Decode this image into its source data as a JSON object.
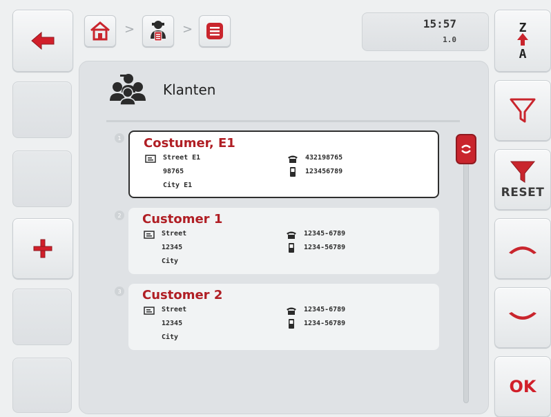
{
  "header": {
    "clock_time": "15:57",
    "version": "1.0",
    "breadcrumb_sep": ">"
  },
  "page": {
    "title": "Klanten"
  },
  "buttons": {
    "reset_label": "RESET",
    "ok_label": "OK"
  },
  "icons": {
    "back": "arrow-left-icon",
    "add": "plus-icon",
    "sort": "sort-za-icon",
    "filter": "filter-icon",
    "reset": "filter-reset-icon",
    "up": "chevron-up-icon",
    "down": "chevron-down-icon",
    "home": "home-icon",
    "customer": "customer-icon",
    "list": "list-menu-icon",
    "address": "address-icon",
    "phone": "phone-icon",
    "mobile": "mobile-icon"
  },
  "colors": {
    "accent_red": "#c9252d",
    "name_red": "#b01e24"
  },
  "customers": [
    {
      "index": "1",
      "name": "Costumer, E1",
      "street": "Street E1",
      "postcode": "98765",
      "city": "City E1",
      "phone": "432198765",
      "mobile": "123456789"
    },
    {
      "index": "2",
      "name": "Customer 1",
      "street": "Street",
      "postcode": "12345",
      "city": "City",
      "phone": "12345-6789",
      "mobile": "1234-56789"
    },
    {
      "index": "3",
      "name": "Customer 2",
      "street": "Street",
      "postcode": "12345",
      "city": "City",
      "phone": "12345-6789",
      "mobile": "1234-56789"
    }
  ]
}
